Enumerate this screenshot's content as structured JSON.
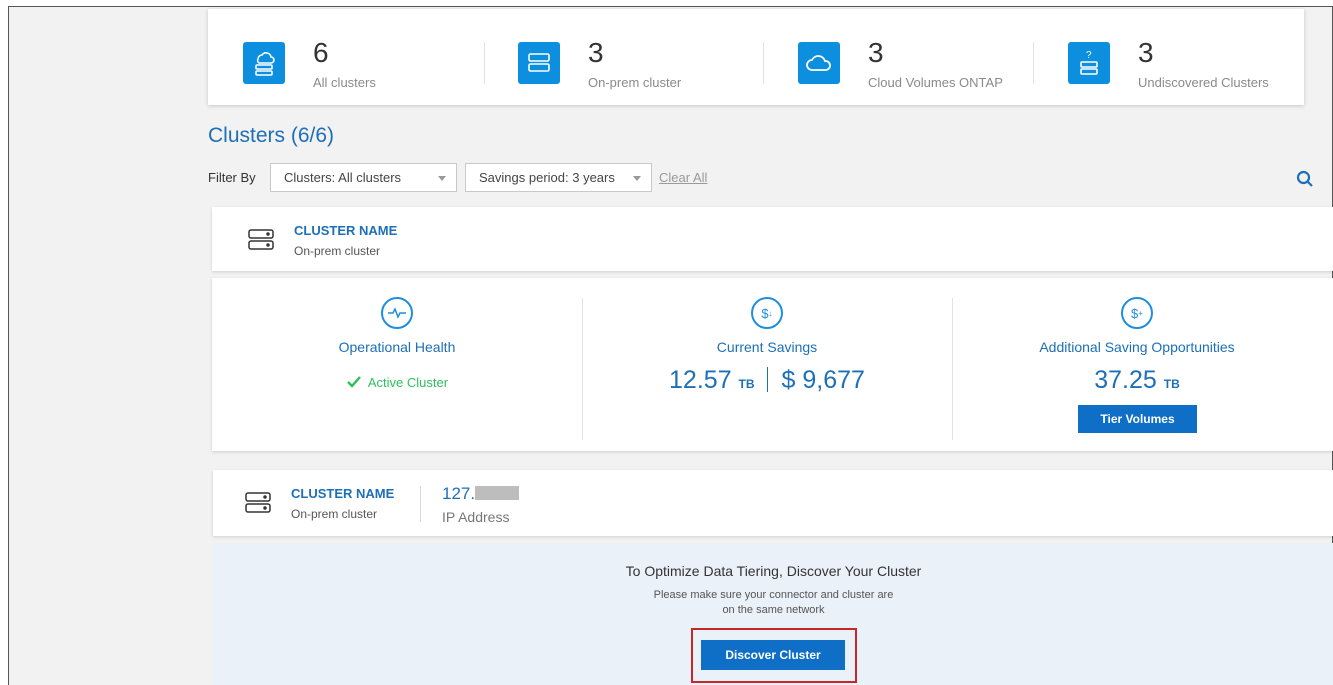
{
  "summary": [
    {
      "count": "6",
      "label": "All clusters",
      "icon": "cluster-stack-icon"
    },
    {
      "count": "3",
      "label": "On-prem cluster",
      "icon": "server-icon"
    },
    {
      "count": "3",
      "label": "Cloud Volumes ONTAP",
      "icon": "cloud-icon"
    },
    {
      "count": "3",
      "label": "Undiscovered Clusters",
      "icon": "unknown-server-icon"
    }
  ],
  "page_title": "Clusters (6/6)",
  "filter": {
    "label": "Filter By",
    "clusters_select": "Clusters: All clusters",
    "period_select": "Savings period: 3 years",
    "clear_all": "Clear All"
  },
  "cluster1": {
    "name": "CLUSTER NAME",
    "type": "On-prem cluster",
    "health": {
      "heading": "Operational Health",
      "status": "Active Cluster"
    },
    "savings": {
      "heading": "Current Savings",
      "capacity": "12.57",
      "unit": "TB",
      "amount": "$ 9,677"
    },
    "opportunities": {
      "heading": "Additional Saving Opportunities",
      "capacity": "37.25",
      "unit": "TB",
      "button": "Tier Volumes"
    }
  },
  "cluster2": {
    "name": "CLUSTER NAME",
    "type": "On-prem cluster",
    "ip_prefix": "127.",
    "ip_label": "IP Address",
    "discover_title": "To Optimize Data Tiering, Discover Your Cluster",
    "discover_line1": "Please make sure your connector and cluster are",
    "discover_line2": "on the same network",
    "discover_button": "Discover Cluster"
  },
  "colors": {
    "accent": "#0f6fc6",
    "icon_bg": "#0d8fe0",
    "success": "#2fbf5f",
    "highlight": "#c62828"
  }
}
